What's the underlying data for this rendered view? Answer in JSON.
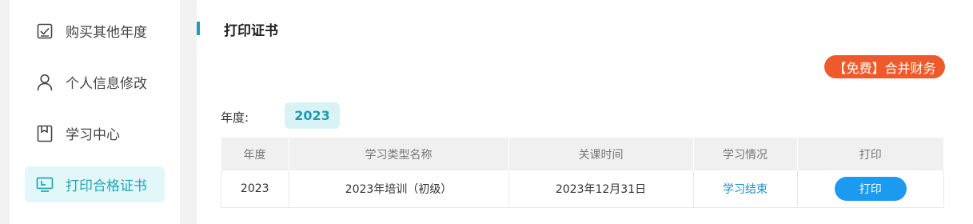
{
  "sidebar": {
    "items": [
      {
        "label": "购买其他年度",
        "icon": "checkbox-icon"
      },
      {
        "label": "个人信息修改",
        "icon": "user-icon"
      },
      {
        "label": "学习中心",
        "icon": "book-icon"
      },
      {
        "label": "打印合格证书",
        "icon": "certificate-icon",
        "active": true
      }
    ]
  },
  "main": {
    "title": "打印证书",
    "promo_button": "【免费】合并财务",
    "year_filter": {
      "label": "年度:",
      "selected": "2023"
    },
    "table": {
      "headers": [
        "年度",
        "学习类型名称",
        "关课时间",
        "学习情况",
        "打印"
      ],
      "rows": [
        {
          "year": "2023",
          "type": "2023年培训（初级）",
          "close_time": "2023年12月31日",
          "status": "学习结束",
          "action": "打印"
        }
      ]
    }
  },
  "colors": {
    "accent": "#1fa7b6",
    "promo": "#ef5a2c",
    "print_button": "#1b9af0"
  }
}
